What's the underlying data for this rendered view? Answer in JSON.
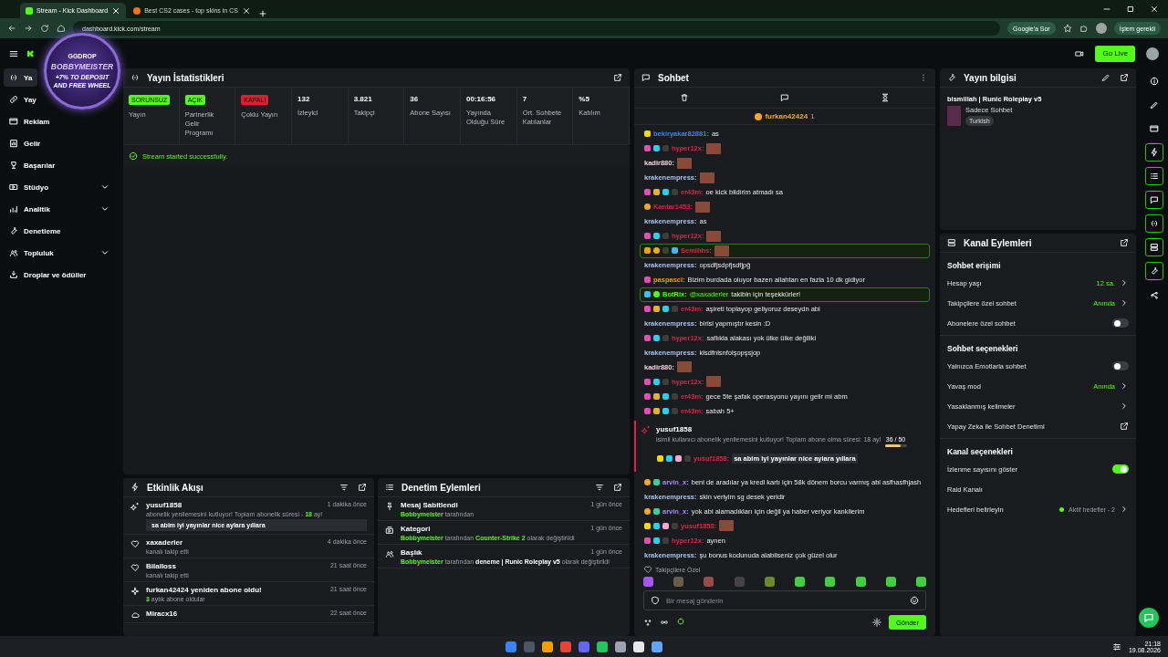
{
  "browser": {
    "tabs": [
      {
        "title": "Stream - Kick Dashboard",
        "selected": true
      },
      {
        "title": "Best CS2 cases - top skins in CS",
        "selected": false
      }
    ],
    "url": "dashboard.kick.com/stream",
    "ask_google": "Google'a Sor",
    "action_needed": "İşlem gerekli"
  },
  "header": {
    "go_live": "Go Live"
  },
  "stream_overlay": {
    "brand": "GGDROP",
    "name": "BOBBYMEISTER",
    "promo": "+7% TO DEPOSIT AND FREE WHEEL"
  },
  "sidebar": {
    "items": [
      {
        "label": "Ya",
        "selected": true,
        "expandable": false
      },
      {
        "label": "Yay",
        "selected": false,
        "expandable": false
      },
      {
        "label": "Reklam",
        "selected": false,
        "expandable": false
      },
      {
        "label": "Gelir",
        "selected": false,
        "expandable": false
      },
      {
        "label": "Başarılar",
        "selected": false,
        "expandable": false
      },
      {
        "label": "Stüdyo",
        "selected": false,
        "expandable": true
      },
      {
        "label": "Analitik",
        "selected": false,
        "expandable": true
      },
      {
        "label": "Denetleme",
        "selected": false,
        "expandable": false
      },
      {
        "label": "Topluluk",
        "selected": false,
        "expandable": true
      },
      {
        "label": "Droplar ve ödüller",
        "selected": false,
        "expandable": false
      }
    ]
  },
  "stats_panel": {
    "title": "Yayın İstatistikleri",
    "stats": [
      {
        "kind": "badge",
        "value": "SORUNSUZ",
        "color": "#53fc18",
        "label": "Yayın"
      },
      {
        "kind": "badge",
        "value": "AÇIK",
        "color": "#53fc18",
        "label": "Partnerlik Gelir Programı"
      },
      {
        "kind": "badge",
        "value": "KAPALI",
        "color": "#e11d2e",
        "label": "Çoklu Yayın"
      },
      {
        "kind": "number",
        "value": "132",
        "label": "İzleyici"
      },
      {
        "kind": "number",
        "value": "3.821",
        "label": "Takipçi"
      },
      {
        "kind": "number",
        "value": "36",
        "label": "Abone Sayısı"
      },
      {
        "kind": "number",
        "value": "00:16:56",
        "label": "Yayında Olduğu Süre"
      },
      {
        "kind": "number",
        "value": "7",
        "label": "Ort. Sohbete Katılanlar"
      },
      {
        "kind": "number",
        "value": "%5",
        "label": "Katılım"
      }
    ],
    "alert": "Stream started successfully."
  },
  "activity_feed": {
    "title": "Etkinlik Akışı",
    "events": [
      {
        "user": "yusuf1858",
        "time": "1 dakika önce",
        "detail": [
          {
            "text": "abonelik yenilemesini kutluyor! Toplam abonelik süresi - ",
            "kind": "plain"
          },
          {
            "text": "18",
            "kind": "accent"
          },
          {
            "text": " ay!",
            "kind": "plain"
          }
        ],
        "message": "sa abim iyi yayınlar nice aylara yıllara"
      },
      {
        "user": "xaxaderler",
        "time": "4 dakika önce",
        "detail": [
          {
            "text": "kanalı takip etti",
            "kind": "plain"
          }
        ]
      },
      {
        "user": "Bilalloss",
        "time": "21 saat önce",
        "detail": [
          {
            "text": "kanalı takip etti",
            "kind": "plain"
          }
        ]
      },
      {
        "user": "furkan42424 yeniden abone oldu!",
        "time": "21 saat önce",
        "detail": [
          {
            "text": "3",
            "kind": "accent"
          },
          {
            "text": " aylık abone oldular",
            "kind": "plain"
          }
        ]
      },
      {
        "user": "Miracx16",
        "time": "22 saat önce"
      }
    ]
  },
  "moderation_panel": {
    "title": "Denetim Eylemleri",
    "actions": [
      {
        "title": "Mesaj Sabitlendi",
        "time": "1 gün önce",
        "detail": [
          {
            "text": "Bobbymeister",
            "kind": "accent"
          },
          {
            "text": " tarafından",
            "kind": "plain"
          }
        ]
      },
      {
        "title": "Kategori",
        "time": "1 gün önce",
        "detail": [
          {
            "text": "Bobbymeister",
            "kind": "accent"
          },
          {
            "text": " tarafından ",
            "kind": "plain"
          },
          {
            "text": "Counter-Strike 2",
            "kind": "accent"
          },
          {
            "text": " olarak değiştirildi",
            "kind": "plain"
          }
        ]
      },
      {
        "title": "Başlık",
        "time": "1 gün önce",
        "detail": [
          {
            "text": "Bobbymeister",
            "kind": "accent"
          },
          {
            "text": " tarafından ",
            "kind": "plain"
          },
          {
            "text": "deneme | Runic Roleplay v5",
            "kind": "strong"
          },
          {
            "text": " olarak değiştirildi",
            "kind": "plain"
          }
        ]
      }
    ]
  },
  "chat": {
    "title": "Sohbet",
    "pinned_user": "furkan42424",
    "pinned_count": "1",
    "messages": [
      {
        "kind": "message",
        "user": "bekiryakar82881:",
        "color": "#3b82f6",
        "text": "as",
        "highlighted": false
      },
      {
        "kind": "message",
        "user": "hyper12x:",
        "color": "#e0204a",
        "highlighted": false
      },
      {
        "kind": "message",
        "user": "kadir880:",
        "color": "#f3d6dc",
        "highlighted": false
      },
      {
        "kind": "message",
        "user": "krakenempress:",
        "color": "#a9c5f0",
        "highlighted": false
      },
      {
        "kind": "message",
        "user": "er43m:",
        "color": "#e0204a",
        "text": "oe kick bildirim atmadı sa",
        "highlighted": false
      },
      {
        "kind": "message",
        "user": "Kantar1453:",
        "color": "#e0204a",
        "highlighted": false
      },
      {
        "kind": "message",
        "user": "krakenempress:",
        "color": "#a9c5f0",
        "text": "as",
        "highlighted": false
      },
      {
        "kind": "message",
        "user": "hyper12x:",
        "color": "#e0204a",
        "highlighted": false
      },
      {
        "kind": "message",
        "user": "Semihhs:",
        "color": "#e0204a",
        "highlighted": true
      },
      {
        "kind": "message",
        "user": "krakenempress:",
        "color": "#a9c5f0",
        "text": "opsdfjsdpfjsdfjpğ",
        "highlighted": false
      },
      {
        "kind": "message",
        "user": "paspasci:",
        "color": "#f59e0b",
        "text": "Bizim burdada oluyor bazen allahtan en fazla 10 dk gidiyor",
        "highlighted": false
      },
      {
        "kind": "message",
        "user": "BotRix:",
        "color": "#53fc18",
        "mention": "@xaxaderler",
        "text": "takibin için teşekkürler!",
        "highlighted": true
      },
      {
        "kind": "message",
        "user": "er43m:",
        "color": "#e0204a",
        "text": "aşireti toplayop geliyoruz deseydn abi",
        "highlighted": false
      },
      {
        "kind": "message",
        "user": "krakenempress:",
        "color": "#a9c5f0",
        "text": "birisi yapmıştır kesin :D",
        "highlighted": false
      },
      {
        "kind": "message",
        "user": "hyper12x:",
        "color": "#e0204a",
        "text": "saflıkla alakası yok ülke ülke değiliki",
        "highlighted": false
      },
      {
        "kind": "message",
        "user": "krakenempress:",
        "color": "#a9c5f0",
        "text": "klsdfnlsnfolşopşsjop",
        "highlighted": false
      },
      {
        "kind": "message",
        "user": "kadir880:",
        "color": "#f3d6dc",
        "highlighted": false
      },
      {
        "kind": "message",
        "user": "hyper12x:",
        "color": "#e0204a",
        "highlighted": false
      },
      {
        "kind": "message",
        "user": "er43m:",
        "color": "#e0204a",
        "text": "gece 5te şafak operasyonu yayını gelir mi abm",
        "highlighted": false
      },
      {
        "kind": "message",
        "user": "er43m:",
        "color": "#e0204a",
        "text": "sabah 5+",
        "highlighted": false
      },
      {
        "kind": "sub_notice",
        "user": "yusuf1858",
        "text": "isimli kullanıcı abonelik yenilemesini kutluyor! Toplam abone olma süresi: 18 ay!",
        "progress": "36 / 50",
        "level": 0.72,
        "message_user": "yusuf1858:",
        "color": "#e0204a",
        "message": "sa abim iyi yayınlar nice aylara yıllara"
      },
      {
        "kind": "message",
        "user": "arvin_x:",
        "color": "#a78bfa",
        "text": "beni de aradılar ya kredi kartı için 58k dönem borcu varmış abi asfhasfhjash",
        "highlighted": false
      },
      {
        "kind": "message",
        "user": "krakenempress:",
        "color": "#a9c5f0",
        "text": "skin veriyim sg desek yeridir",
        "highlighted": false
      },
      {
        "kind": "message",
        "user": "arvin_x:",
        "color": "#a78bfa",
        "text": "yok abi alamadıkları için değil ya haber veriyor kankilerim",
        "highlighted": false
      },
      {
        "kind": "message",
        "user": "yusuf1858:",
        "color": "#e0204a",
        "highlighted": false
      },
      {
        "kind": "message",
        "user": "hyper12x:",
        "color": "#e0204a",
        "text": "aynen",
        "highlighted": false
      },
      {
        "kind": "message",
        "user": "krakenempress:",
        "color": "#a9c5f0",
        "text": "şu bonus kodunuda alabilseniz çok güzel olur",
        "highlighted": false
      }
    ],
    "emote_section": "Takipçilere Özel",
    "input_placeholder": "Bir mesaj gönderin",
    "send": "Gönder"
  },
  "stream_info": {
    "title": "Yayın bilgisi",
    "stream_title": "bismillah | Runic Roleplay v5",
    "category": "Sadece Sohbet",
    "tag": "Turkish"
  },
  "channel_actions": {
    "title": "Kanal Eylemleri",
    "sections": [
      {
        "title": "Sohbet erişimi",
        "rows": [
          {
            "kind": "value",
            "label": "Hesap yaşı",
            "value": "12 sa."
          },
          {
            "kind": "value",
            "label": "Takipçilere özel sohbet",
            "value": "Anında"
          },
          {
            "kind": "toggle",
            "label": "Abonelere özel sohbet",
            "on": false
          }
        ]
      },
      {
        "title": "Sohbet seçenekleri",
        "rows": [
          {
            "kind": "toggle",
            "label": "Yalnızca Emotlarla sohbet",
            "on": false
          },
          {
            "kind": "value",
            "label": "Yavaş mod",
            "value": "Anında"
          },
          {
            "kind": "link",
            "label": "Yasaklanmış kelimeler"
          },
          {
            "kind": "external",
            "label": "Yapay Zeka ile Sohbet Denetimi"
          }
        ]
      },
      {
        "title": "Kanal seçenekleri",
        "rows": [
          {
            "kind": "toggle",
            "label": "İzlenme sayısını göster",
            "on": true
          },
          {
            "kind": "plain",
            "label": "Raid Kanalı"
          },
          {
            "kind": "goal",
            "label": "Hedefleri belirleyin",
            "value": "Aktif hedefler - 2"
          }
        ]
      }
    ]
  },
  "rail": [
    {
      "active": false
    },
    {
      "active": false
    },
    {
      "active": false
    },
    {
      "active": true
    },
    {
      "active": true
    },
    {
      "active": true
    },
    {
      "active": true
    },
    {
      "active": true
    },
    {
      "active": true
    },
    {
      "active": false
    }
  ],
  "taskbar": {
    "time": "21:18",
    "date": "19.08.2026"
  }
}
